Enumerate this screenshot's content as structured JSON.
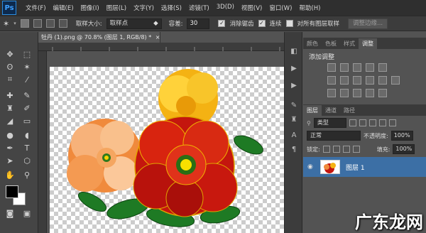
{
  "app": {
    "logo": "Ps"
  },
  "menu": [
    "文件(F)",
    "编辑(E)",
    "图像(I)",
    "图层(L)",
    "文字(Y)",
    "选择(S)",
    "滤镜(T)",
    "3D(D)",
    "视图(V)",
    "窗口(W)",
    "帮助(H)"
  ],
  "options": {
    "sample_size_label": "取样大小:",
    "sample_size_value": "取样点",
    "tolerance_label": "容差:",
    "tolerance_value": "30",
    "antialias_label": "消除锯齿",
    "contiguous_label": "连续",
    "sample_all_label": "对所有图层取样",
    "refine_edge_label": "调整边缘..."
  },
  "document": {
    "tab_title": "牡丹 (1).png @ 70.8% (图层 1, RGB/8) *"
  },
  "panels": {
    "top_tabs": [
      "颜色",
      "色板",
      "样式",
      "调整"
    ],
    "adjust_title": "添加调整",
    "layer_tabs": [
      "图层",
      "通道",
      "路径"
    ],
    "filter_type": "类型",
    "blend_mode": "正常",
    "opacity_label": "不透明度:",
    "opacity_value": "100%",
    "lock_label": "锁定:",
    "fill_label": "填充:",
    "fill_value": "100%",
    "layer_name": "图层 1"
  },
  "watermark": "广东龙网",
  "colors": {
    "menubar": "#2f2f2f",
    "selected_layer": "#3c6fa5",
    "panel": "#535353"
  }
}
